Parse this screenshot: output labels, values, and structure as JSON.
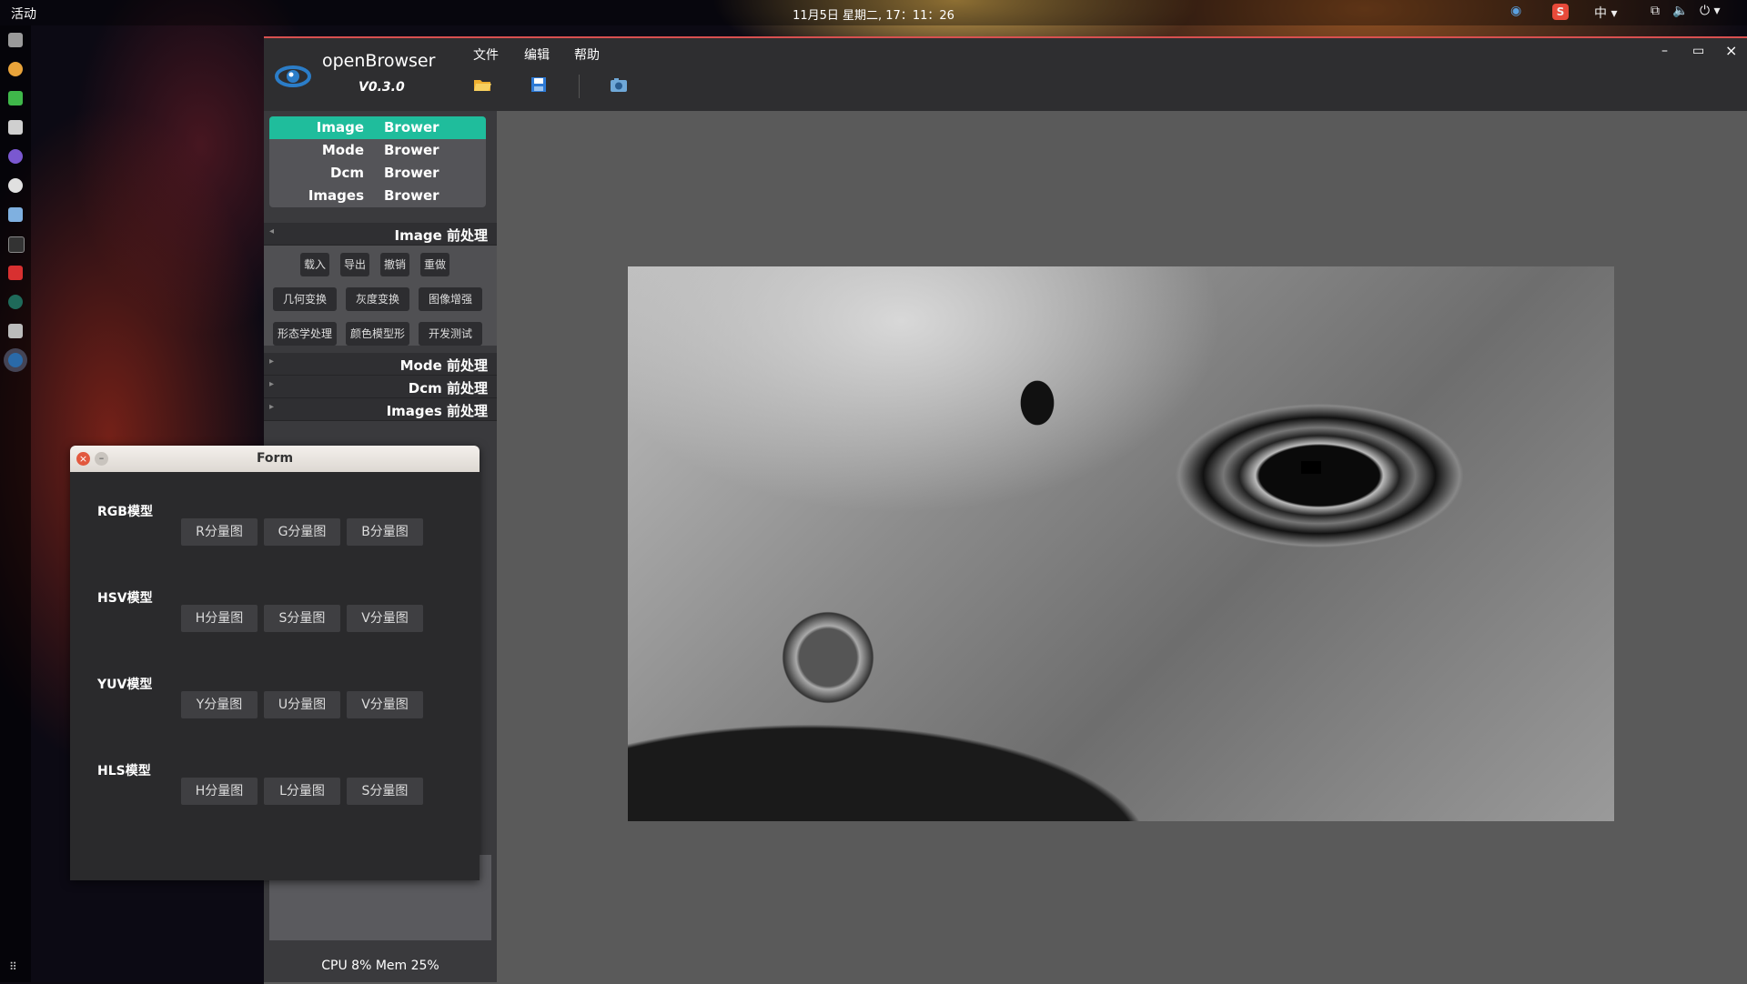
{
  "topbar": {
    "activities": "活动",
    "clock": "11月5日 星期二, 17：11：26",
    "input_method": "中"
  },
  "window": {
    "app_title": "openBrowser",
    "version": "V0.3.0",
    "menus": [
      "文件",
      "编辑",
      "帮助"
    ],
    "controls": {
      "minimize": "–",
      "maximize": "▭",
      "close": "×"
    },
    "accent": "#1fbd9c"
  },
  "browser_list": [
    {
      "a": "Image",
      "b": "Brower",
      "active": true
    },
    {
      "a": "Mode",
      "b": "Brower",
      "active": false
    },
    {
      "a": "Dcm",
      "b": "Brower",
      "active": false
    },
    {
      "a": "Images",
      "b": "Brower",
      "active": false
    }
  ],
  "sections": {
    "image": "Image 前处理",
    "mode": "Mode 前处理",
    "dcm": "Dcm 前处理",
    "images": "Images 前处理"
  },
  "image_buttons": {
    "row1": [
      "载入",
      "导出",
      "撤销",
      "重做"
    ],
    "row2": [
      "几何变换",
      "灰度变换",
      "图像增强"
    ],
    "row3": [
      "形态学处理",
      "颜色模型形",
      "开发测试"
    ]
  },
  "status": "CPU 8%  Mem 25%",
  "form": {
    "title": "Form",
    "groups": [
      {
        "label": "RGB模型",
        "buttons": [
          "R分量图",
          "G分量图",
          "B分量图"
        ]
      },
      {
        "label": "HSV模型",
        "buttons": [
          "H分量图",
          "S分量图",
          "V分量图"
        ]
      },
      {
        "label": "YUV模型",
        "buttons": [
          "Y分量图",
          "U分量图",
          "V分量图"
        ]
      },
      {
        "label": "HLS模型",
        "buttons": [
          "H分量图",
          "L分量图",
          "S分量图"
        ]
      }
    ]
  }
}
